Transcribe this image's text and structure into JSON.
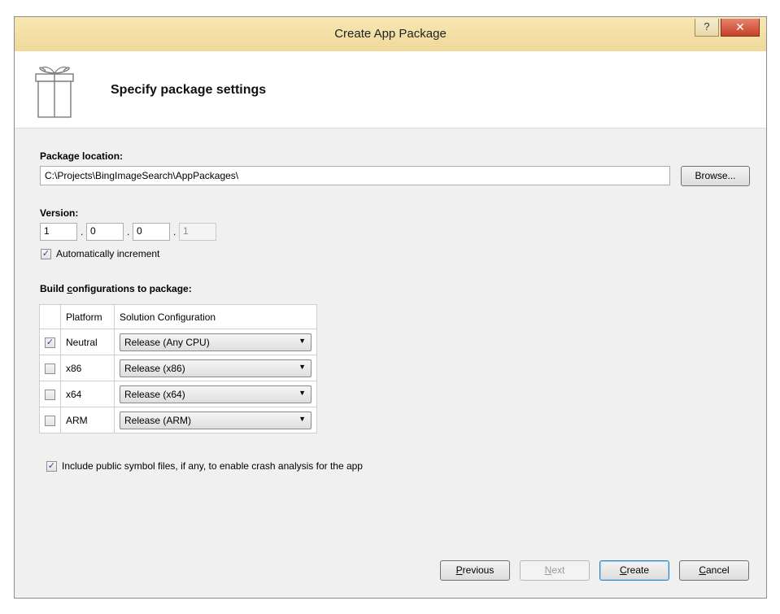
{
  "window": {
    "title": "Create App Package",
    "help_label": "?",
    "close_label": "✕"
  },
  "header": {
    "title": "Specify package settings",
    "icon": "gift-box-icon"
  },
  "package_location": {
    "label": "Package location:",
    "value": "C:\\Projects\\BingImageSearch\\AppPackages\\",
    "browse_label": "Browse..."
  },
  "version": {
    "label": "Version:",
    "major": "1",
    "minor": "0",
    "build": "0",
    "revision": "1",
    "separator": ".",
    "auto_increment_label": "Automatically increment",
    "auto_increment_checked": true
  },
  "build_configs": {
    "label_prefix": "Build ",
    "label_accel": "c",
    "label_suffix": "onfigurations to package:",
    "headers": {
      "platform": "Platform",
      "configuration": "Solution Configuration"
    },
    "rows": [
      {
        "checked": true,
        "platform": "Neutral",
        "configuration": "Release (Any CPU)"
      },
      {
        "checked": false,
        "platform": "x86",
        "configuration": "Release (x86)"
      },
      {
        "checked": false,
        "platform": "x64",
        "configuration": "Release (x64)"
      },
      {
        "checked": false,
        "platform": "ARM",
        "configuration": "Release (ARM)"
      }
    ]
  },
  "symbols": {
    "label": "Include public symbol files, if any, to enable crash analysis for the app",
    "checked": true
  },
  "footer": {
    "previous": {
      "accel": "P",
      "rest": "revious"
    },
    "next": {
      "accel": "N",
      "rest": "ext"
    },
    "create": {
      "accel": "C",
      "rest": "reate"
    },
    "cancel": {
      "accel": "C",
      "rest": "ancel"
    }
  },
  "colors": {
    "titlebar": "#efd99a",
    "close": "#c4402a",
    "dialog_bg": "#f0f0f0"
  }
}
